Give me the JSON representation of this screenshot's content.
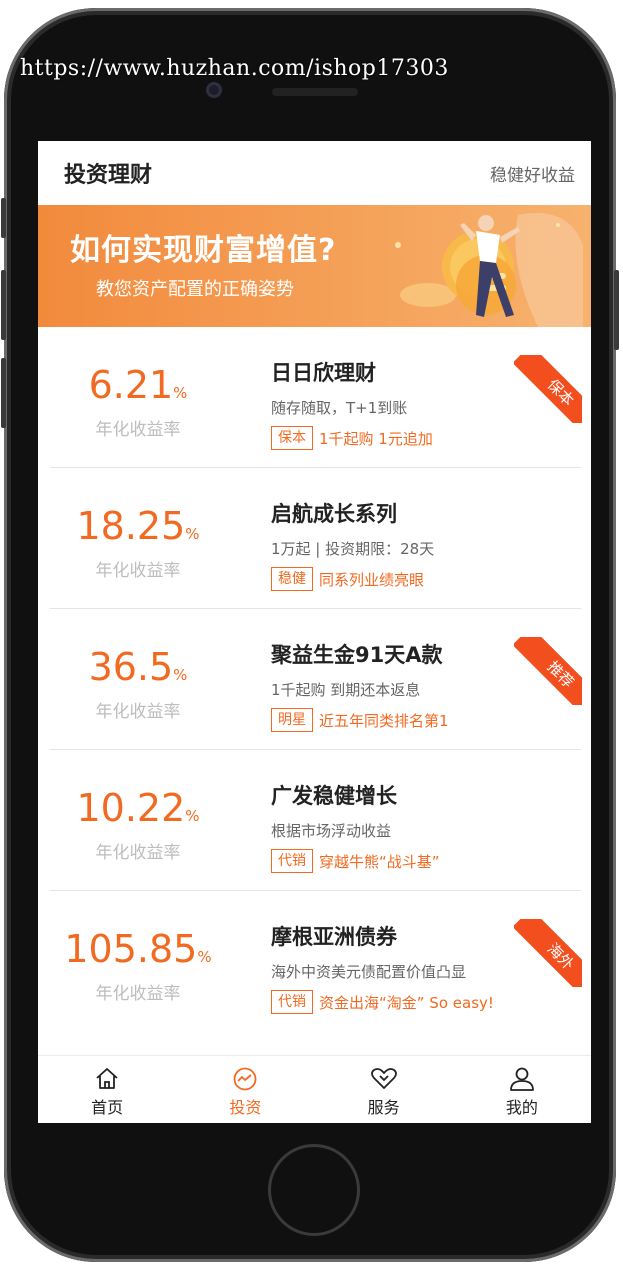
{
  "watermark": "https://www.huzhan.com/ishop17303",
  "header": {
    "title": "投资理财",
    "right": "稳健好收益"
  },
  "banner": {
    "title": "如何实现财富增值?",
    "subtitle": "教您资产配置的正确姿势"
  },
  "products": [
    {
      "rate": "6.21",
      "unit": "%",
      "rate_label": "年化收益率",
      "name": "日日欣理财",
      "desc": "随存随取，T+1到账",
      "tag": "保本",
      "tag_text": "1千起购 1元追加",
      "ribbon": "保本"
    },
    {
      "rate": "18.25",
      "unit": "%",
      "rate_label": "年化收益率",
      "name": "启航成长系列",
      "desc": "1万起 | 投资期限：28天",
      "tag": "稳健",
      "tag_text": "同系列业绩亮眼",
      "ribbon": ""
    },
    {
      "rate": "36.5",
      "unit": "%",
      "rate_label": "年化收益率",
      "name": "聚益生金91天A款",
      "desc": "1千起购 到期还本返息",
      "tag": "明星",
      "tag_text": "近五年同类排名第1",
      "ribbon": "推荐"
    },
    {
      "rate": "10.22",
      "unit": "%",
      "rate_label": "年化收益率",
      "name": "广发稳健增长",
      "desc": "根据市场浮动收益",
      "tag": "代销",
      "tag_text": "穿越牛熊“战斗基”",
      "ribbon": ""
    },
    {
      "rate": "105.85",
      "unit": "%",
      "rate_label": "年化收益率",
      "name": "摩根亚洲债券",
      "desc": "海外中资美元债配置价值凸显",
      "tag": "代销",
      "tag_text": "资金出海“淘金” So easy!",
      "ribbon": "海外"
    }
  ],
  "tabbar": [
    {
      "label": "首页",
      "icon": "home-icon",
      "active": false
    },
    {
      "label": "投资",
      "icon": "invest-chart-icon",
      "active": true
    },
    {
      "label": "服务",
      "icon": "service-heart-icon",
      "active": false
    },
    {
      "label": "我的",
      "icon": "user-icon",
      "active": false
    }
  ],
  "colors": {
    "accent": "#f26a21",
    "ribbon": "#f24e1e",
    "banner": "#f28a3c"
  }
}
